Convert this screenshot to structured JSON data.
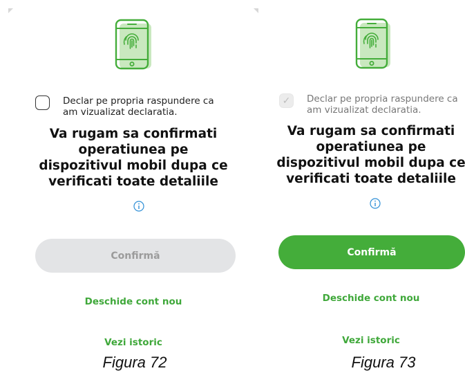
{
  "colors": {
    "accent": "#44ad3a",
    "disabled_bg": "#e3e4e6",
    "disabled_text": "#9b9b9b"
  },
  "screens": [
    {
      "checkbox_checked": false,
      "consent_text_line1": "Declar pe propria raspundere ca",
      "consent_text_line2": "am vizualizat declaratia.",
      "headline_line1": "Va rugam sa confirmati",
      "headline_line2": "operatiunea pe",
      "headline_line3": "dispozitivul mobil dupa ce",
      "headline_line4": "verificati toate detaliile",
      "confirm_label": "Confirmă",
      "confirm_state": "disabled",
      "open_account_label": "Deschide cont nou",
      "history_label": "Vezi istoric",
      "caption": "Figura 72"
    },
    {
      "checkbox_checked": true,
      "consent_text_line1": "Declar pe propria raspundere ca",
      "consent_text_line2": "am vizualizat declaratia.",
      "headline_line1": "Va rugam sa confirmati",
      "headline_line2": "operatiunea pe",
      "headline_line3": "dispozitivul mobil dupa ce",
      "headline_line4": "verificati toate detaliile",
      "confirm_label": "Confirmă",
      "confirm_state": "enabled",
      "open_account_label": "Deschide cont nou",
      "history_label": "Vezi istoric",
      "caption": "Figura 73"
    }
  ],
  "icons": {
    "phone": "phone-fingerprint-icon",
    "info": "info-icon",
    "check": "check-icon"
  }
}
